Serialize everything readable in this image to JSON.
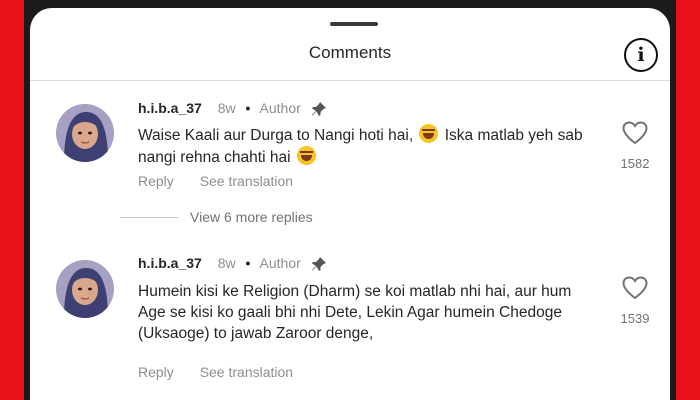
{
  "header": {
    "title": "Comments",
    "info_icon": "info-icon"
  },
  "comments": [
    {
      "username": "h.i.b.a_37",
      "time": "8w",
      "separator": "•",
      "author_label": "Author",
      "text_parts": [
        "Waise Kaali aur Durga to Nangi hoti hai, ",
        " Iska matlab yeh sab nangi rehna chahti hai "
      ],
      "emoji": "face-with-tears-of-joy",
      "reply_label": "Reply",
      "translate_label": "See translation",
      "likes": "1582"
    },
    {
      "username": "h.i.b.a_37",
      "time": "8w",
      "separator": "•",
      "author_label": "Author",
      "text": "Humein kisi ke Religion (Dharm) se koi matlab nhi hai, aur hum Age se kisi ko gaali bhi nhi Dete, Lekin Agar humein Chedoge (Uksaoge) to jawab Zaroor denge,",
      "reply_label": "Reply",
      "translate_label": "See translation",
      "likes": "1539"
    }
  ],
  "view_more_replies": "View 6 more replies",
  "colors": {
    "frame": "#e8111a",
    "sheet": "#ffffff",
    "text_primary": "#262626",
    "text_secondary": "#8e8e8e"
  }
}
